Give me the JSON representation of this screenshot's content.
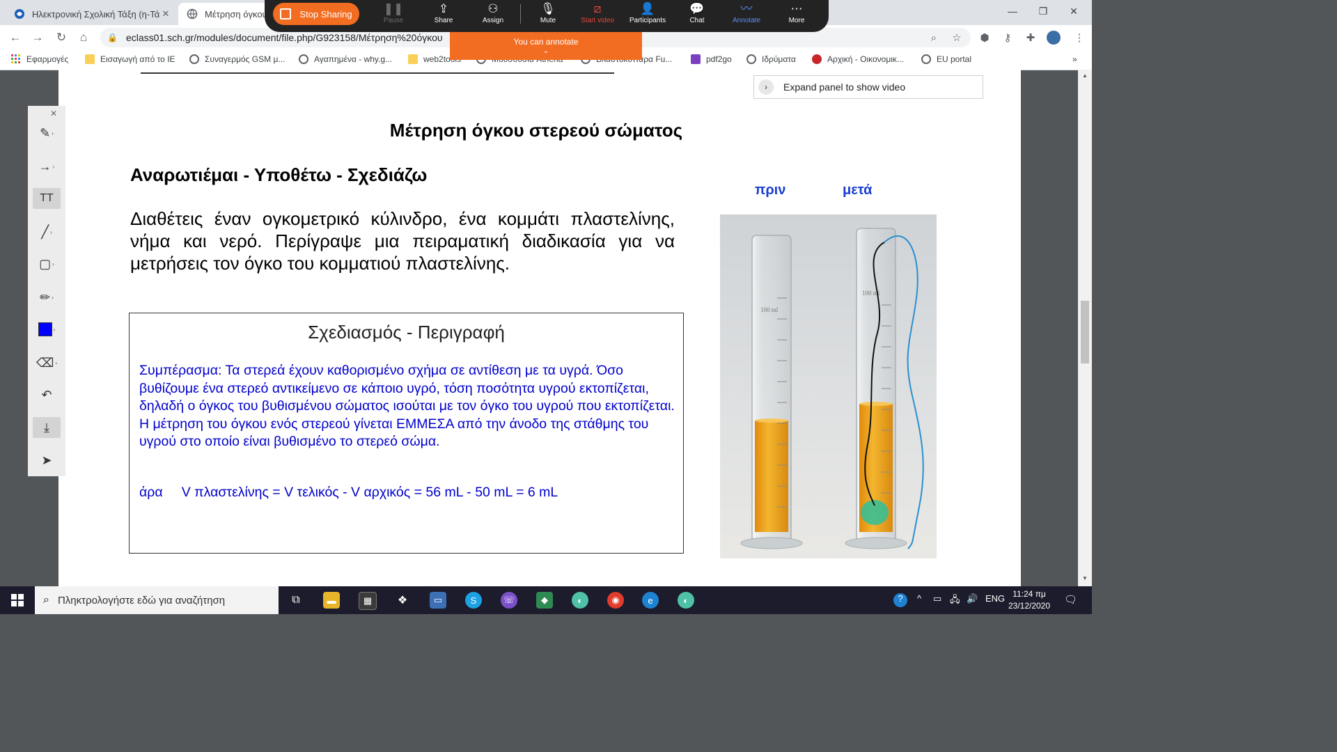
{
  "browser": {
    "tabs": [
      {
        "title": "Ηλεκτρονική Σχολική Τάξη (η-Τάξη)",
        "active": false
      },
      {
        "title": "Μέτρηση όγκου στερεού",
        "active": true
      }
    ],
    "url": "eclass01.sch.gr/modules/document/file.php/G923158/Μέτρηση%20όγκου",
    "bookmarks": [
      {
        "label": "Εφαρμογές",
        "icon": "apps-grid-icon"
      },
      {
        "label": "Εισαγωγή από το IE",
        "icon": "folder-icon"
      },
      {
        "label": "Συναγερμός GSM μ...",
        "icon": "globe-icon"
      },
      {
        "label": "Αγαπημένα - why.g...",
        "icon": "globe-icon"
      },
      {
        "label": "web2tools",
        "icon": "folder-icon"
      },
      {
        "label": "Μουσουσία Athena",
        "icon": "globe-icon"
      },
      {
        "label": "Βλαστοκύτταρα Fu...",
        "icon": "globe-icon"
      },
      {
        "label": "pdf2go",
        "icon": "pdf2go-icon"
      },
      {
        "label": "Ιδρύματα",
        "icon": "globe-icon"
      },
      {
        "label": "Αρχική - Οικονομικ...",
        "icon": "site-red-icon"
      },
      {
        "label": "EU portal",
        "icon": "globe-icon"
      }
    ],
    "more_bookmarks": "»"
  },
  "zoom": {
    "stop_sharing": "Stop Sharing",
    "buttons": [
      {
        "label": "Pause",
        "icon": "pause-icon",
        "state": "dim"
      },
      {
        "label": "Share",
        "icon": "share-icon",
        "state": "normal"
      },
      {
        "label": "Assign",
        "icon": "assign-icon",
        "state": "normal"
      },
      {
        "label": "Mute",
        "icon": "microphone-icon",
        "state": "normal"
      },
      {
        "label": "Start video",
        "icon": "video-off-icon",
        "state": "red"
      },
      {
        "label": "Participants",
        "icon": "participants-icon",
        "state": "normal"
      },
      {
        "label": "Chat",
        "icon": "chat-icon",
        "state": "normal"
      },
      {
        "label": "Annotate",
        "icon": "annotate-icon",
        "state": "blue"
      },
      {
        "label": "More",
        "icon": "more-icon",
        "state": "normal"
      }
    ],
    "annotate_banner": "You can annotate"
  },
  "viewer": {
    "expand_panel": "Expand panel to show video"
  },
  "document": {
    "title": "Μέτρηση όγκου στερεού σώματος",
    "heading": "Αναρωτιέμαι - Υποθέτω - Σχεδιάζω",
    "task": "Διαθέτεις έναν ογκομετρικό κύλινδρο, ένα κομμάτι πλαστελίνης, νήμα και νερό. Περίγραψε μια πειραματική διαδικασία για να μετρήσεις τον όγκο του κομματιού πλαστελίνης.",
    "design_title": "Σχεδιασμός - Περιγραφή",
    "conclusion": "Συμπέρασμα: Τα στερεά έχουν καθορισμένο σχήμα σε αντίθεση με τα υγρά. Όσο βυθίζουμε ένα στερεό αντικείμενο σε κάποιο υγρό, τόση ποσότητα υγρού εκτοπίζεται, δηλαδή ο όγκος του βυθισμένου σώματος ισούται με τον όγκο του υγρού που εκτοπίζεται. Η μέτρηση του όγκου ενός στερεού γίνεται ΕΜΜΕΣΑ από την άνοδο της στάθμης του υγρού στο οποίο είναι βυθισμένο το στερεό σώμα.",
    "formula_prefix": "άρα",
    "formula": "V πλαστελίνης = V τελικός - V αρχικός = 56 mL - 50 mL = 6 mL",
    "before_label": "πριν",
    "after_label": "μετά",
    "cylinder_marks": [
      "100 ml",
      "100 ml"
    ]
  },
  "taskbar": {
    "search_placeholder": "Πληκτρολογήστε εδώ για αναζήτηση",
    "language": "ENG",
    "time": "11:24 πμ",
    "date": "23/12/2020"
  },
  "colors": {
    "annotation_color": "#0000ff",
    "zoom_orange": "#f26d21",
    "text_blue": "#0000cc",
    "label_blue": "#1a3ecf"
  }
}
